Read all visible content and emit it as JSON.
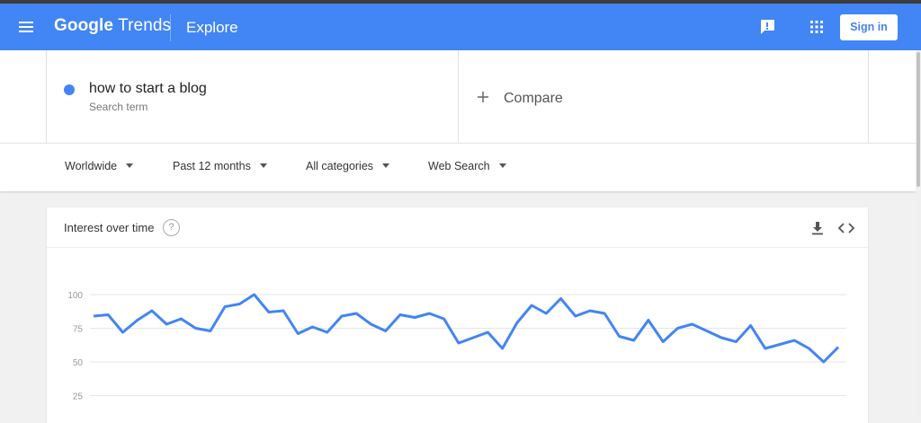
{
  "header": {
    "logo_google": "Google",
    "logo_trends": "Trends",
    "page_title": "Explore",
    "sign_in_label": "Sign in",
    "icons": [
      "menu-icon",
      "feedback-icon",
      "apps-icon"
    ]
  },
  "search": {
    "term": "how to start a blog",
    "term_sublabel": "Search term",
    "term_color": "#4285f4",
    "compare_label": "Compare"
  },
  "filters": [
    {
      "label": "Worldwide"
    },
    {
      "label": "Past 12 months"
    },
    {
      "label": "All categories"
    },
    {
      "label": "Web Search"
    }
  ],
  "card": {
    "title": "Interest over time",
    "help_symbol": "?",
    "icons": [
      "help-icon",
      "download-icon",
      "embed-icon"
    ]
  },
  "chart_data": {
    "type": "line",
    "series": [
      {
        "color": "#4285f4",
        "values": [
          84,
          85,
          72,
          81,
          88,
          78,
          82,
          75,
          73,
          91,
          93,
          100,
          87,
          88,
          71,
          76,
          72,
          84,
          86,
          78,
          73,
          85,
          83,
          86,
          82,
          64,
          68,
          72,
          60,
          79,
          92,
          86,
          97,
          84,
          88,
          86,
          69,
          66,
          81,
          65,
          75,
          78,
          73,
          68,
          65,
          77,
          60,
          63,
          66,
          60,
          50,
          61
        ]
      }
    ],
    "y_ticks": [
      100,
      75,
      50,
      25
    ],
    "ylim": [
      0,
      100
    ],
    "grid": true,
    "line_color": "#4285f4"
  }
}
